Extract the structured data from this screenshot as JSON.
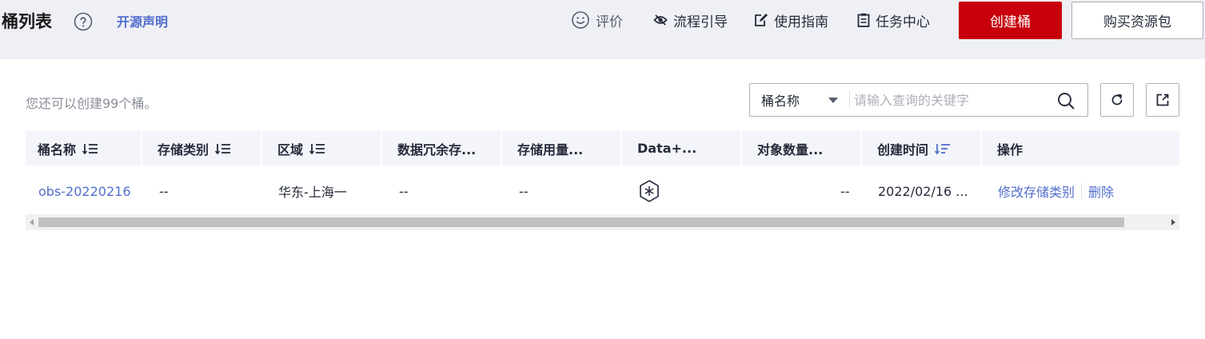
{
  "header": {
    "title": "桶列表",
    "open_source_label": "开源声明",
    "links": {
      "rate": "评价",
      "flow_guide": "流程引导",
      "user_guide": "使用指南",
      "task_center": "任务中心"
    },
    "create_button": "创建桶",
    "buy_button": "购买资源包"
  },
  "toolbar": {
    "quota_text": "您还可以创建99个桶。",
    "search_field_selected": "桶名称",
    "search_placeholder": "请输入查询的关键字"
  },
  "table": {
    "columns": [
      "桶名称",
      "存储类别",
      "区域",
      "数据冗余存...",
      "存储用量...",
      "Data+...",
      "对象数量...",
      "创建时间",
      "操作"
    ],
    "rows": [
      {
        "name": "obs-20220216",
        "storage_class": "--",
        "region": "华东-上海一",
        "redundancy": "--",
        "usage": "--",
        "data_plus_icon": "snowflake-hexagon-icon",
        "object_count": "--",
        "created": "2022/02/16 ...",
        "actions": [
          "修改存储类别",
          "删除"
        ]
      }
    ]
  },
  "colors": {
    "brand_red": "#c7000b",
    "link_blue": "#526ecc",
    "page_bg": "#eff0f5",
    "header_row_bg": "#f3f5fb"
  }
}
